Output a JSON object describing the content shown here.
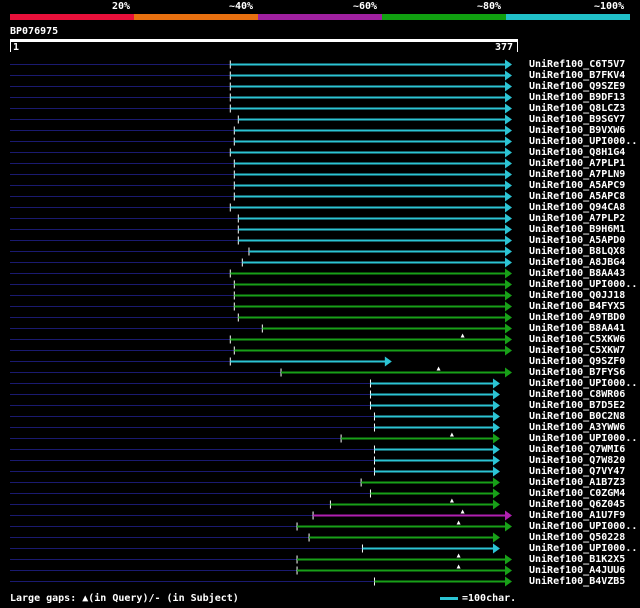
{
  "legend": {
    "labels": [
      "20%",
      "~40%",
      "~60%",
      "~80%",
      "~100%"
    ],
    "colors": [
      "#e8103a",
      "#e87010",
      "#a020a0",
      "#10a010",
      "#20c0c8"
    ]
  },
  "query": {
    "name": "BP076975",
    "start_label": "1",
    "end_label": "377",
    "length": 377
  },
  "hits": [
    {
      "label": "UniRef100_C6T5V7",
      "start": 166,
      "end": 377,
      "color": "cyan"
    },
    {
      "label": "UniRef100_B7FKV4",
      "start": 166,
      "end": 377,
      "color": "cyan"
    },
    {
      "label": "UniRef100_Q9SZE9",
      "start": 166,
      "end": 377,
      "color": "cyan"
    },
    {
      "label": "UniRef100_B9DF13",
      "start": 166,
      "end": 377,
      "color": "cyan"
    },
    {
      "label": "UniRef100_Q8LCZ3",
      "start": 166,
      "end": 377,
      "color": "cyan"
    },
    {
      "label": "UniRef100_B9SGY7",
      "start": 172,
      "end": 377,
      "color": "cyan"
    },
    {
      "label": "UniRef100_B9VXW6",
      "start": 169,
      "end": 377,
      "color": "cyan"
    },
    {
      "label": "UniRef100_UPI000..",
      "start": 169,
      "end": 377,
      "color": "cyan"
    },
    {
      "label": "UniRef100_Q8H1G4",
      "start": 166,
      "end": 377,
      "color": "cyan"
    },
    {
      "label": "UniRef100_A7PLP1",
      "start": 169,
      "end": 377,
      "color": "cyan"
    },
    {
      "label": "UniRef100_A7PLN9",
      "start": 169,
      "end": 377,
      "color": "cyan"
    },
    {
      "label": "UniRef100_A5APC9",
      "start": 169,
      "end": 377,
      "color": "cyan"
    },
    {
      "label": "UniRef100_A5APC8",
      "start": 169,
      "end": 377,
      "color": "cyan"
    },
    {
      "label": "UniRef100_Q94CA8",
      "start": 166,
      "end": 377,
      "color": "cyan"
    },
    {
      "label": "UniRef100_A7PLP2",
      "start": 172,
      "end": 377,
      "color": "cyan"
    },
    {
      "label": "UniRef100_B9H6M1",
      "start": 172,
      "end": 377,
      "color": "cyan"
    },
    {
      "label": "UniRef100_A5APD0",
      "start": 172,
      "end": 377,
      "color": "cyan"
    },
    {
      "label": "UniRef100_B8LQX8",
      "start": 180,
      "end": 377,
      "color": "cyan"
    },
    {
      "label": "UniRef100_A8JBG4",
      "start": 175,
      "end": 377,
      "color": "cyan"
    },
    {
      "label": "UniRef100_B8AA43",
      "start": 166,
      "end": 377,
      "color": "green"
    },
    {
      "label": "UniRef100_UPI000..",
      "start": 169,
      "end": 377,
      "color": "green"
    },
    {
      "label": "UniRef100_Q0JJ18",
      "start": 169,
      "end": 377,
      "color": "green"
    },
    {
      "label": "UniRef100_B4FYX5",
      "start": 169,
      "end": 377,
      "color": "green"
    },
    {
      "label": "UniRef100_A9TBD0",
      "start": 172,
      "end": 377,
      "color": "green"
    },
    {
      "label": "UniRef100_B8AA41",
      "start": 190,
      "end": 377,
      "color": "green"
    },
    {
      "label": "UniRef100_C5XKW6",
      "start": 166,
      "end": 377,
      "color": "green",
      "gap": 340
    },
    {
      "label": "UniRef100_C5XKW7",
      "start": 169,
      "end": 377,
      "color": "green"
    },
    {
      "label": "UniRef100_Q9SZF0",
      "start": 166,
      "end": 287,
      "color": "cyan"
    },
    {
      "label": "UniRef100_B7FYS6",
      "start": 204,
      "end": 377,
      "color": "green",
      "gap": 322
    },
    {
      "label": "UniRef100_UPI000..",
      "start": 271,
      "end": 368,
      "color": "cyan"
    },
    {
      "label": "UniRef100_C8WR06",
      "start": 271,
      "end": 368,
      "color": "cyan"
    },
    {
      "label": "UniRef100_B7D5E2",
      "start": 271,
      "end": 368,
      "color": "cyan"
    },
    {
      "label": "UniRef100_B0C2N8",
      "start": 274,
      "end": 368,
      "color": "cyan"
    },
    {
      "label": "UniRef100_A3YWW6",
      "start": 274,
      "end": 368,
      "color": "cyan"
    },
    {
      "label": "UniRef100_UPI000..",
      "start": 249,
      "end": 368,
      "color": "green",
      "gap": 332
    },
    {
      "label": "UniRef100_Q7WMI6",
      "start": 274,
      "end": 368,
      "color": "cyan"
    },
    {
      "label": "UniRef100_Q7W820",
      "start": 274,
      "end": 368,
      "color": "cyan"
    },
    {
      "label": "UniRef100_Q7VY47",
      "start": 274,
      "end": 368,
      "color": "cyan"
    },
    {
      "label": "UniRef100_A1B7Z3",
      "start": 264,
      "end": 368,
      "color": "green"
    },
    {
      "label": "UniRef100_C0ZGM4",
      "start": 271,
      "end": 368,
      "color": "green"
    },
    {
      "label": "UniRef100_Q6Z045",
      "start": 241,
      "end": 368,
      "color": "green",
      "gap": 332
    },
    {
      "label": "UniRef100_A1U7F9",
      "start": 228,
      "end": 377,
      "color": "purple",
      "gap": 340
    },
    {
      "label": "UniRef100_UPI000..",
      "start": 216,
      "end": 377,
      "color": "green",
      "gap": 337
    },
    {
      "label": "UniRef100_Q50228",
      "start": 225,
      "end": 368,
      "color": "green"
    },
    {
      "label": "UniRef100_UPI000..",
      "start": 265,
      "end": 368,
      "color": "cyan"
    },
    {
      "label": "UniRef100_B1K2X5",
      "start": 216,
      "end": 377,
      "color": "green",
      "gap": 337
    },
    {
      "label": "UniRef100_A4JUU6",
      "start": 216,
      "end": 377,
      "color": "green",
      "gap": 337
    },
    {
      "label": "UniRef100_B4VZB5",
      "start": 274,
      "end": 377,
      "color": "green"
    }
  ],
  "footer": {
    "text": "Large gaps: ▲(in Query)/- (in Subject)",
    "scale": "=100char."
  }
}
